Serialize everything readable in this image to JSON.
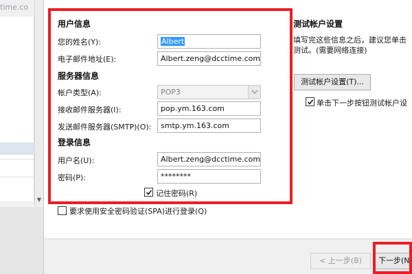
{
  "background": {
    "crumb_text": "time.co"
  },
  "user_info": {
    "title": "用户信息",
    "name_label": "您的姓名(Y):",
    "name_value": "Albert",
    "email_label": "电子邮件地址(E):",
    "email_value": "Albert.zeng@dcctime.com"
  },
  "server_info": {
    "title": "服务器信息",
    "account_type_label": "帐户类型(A):",
    "account_type_value": "POP3",
    "incoming_label": "接收邮件服务器(I):",
    "incoming_value": "pop.ym.163.com",
    "outgoing_label": "发送邮件服务器(SMTP)(O):",
    "outgoing_value": "smtp.ym.163.com"
  },
  "login_info": {
    "title": "登录信息",
    "username_label": "用户名(U):",
    "username_value": "Albert.zeng@dcctime.com",
    "password_label": "密码(P):",
    "password_value": "********",
    "remember_label": "记住密码(R)",
    "remember_checked": true
  },
  "spa": {
    "label": "要求使用安全密码验证(SPA)进行登录(Q)",
    "checked": false
  },
  "test_settings": {
    "title": "测试帐户设置",
    "description_line1": "填写完这些信息之后，建议您单击",
    "description_line2": "测试。(需要网络连接)",
    "button_label": "测试帐户设置(T)...",
    "auto_test_label": "单击下一步按钮测试帐户设",
    "auto_test_checked": true
  },
  "footer": {
    "back_label": "< 上一步(B)",
    "next_label": "下一步(N"
  },
  "colors": {
    "highlight_red": "#ee1c25",
    "selection_blue": "#3399ff"
  }
}
